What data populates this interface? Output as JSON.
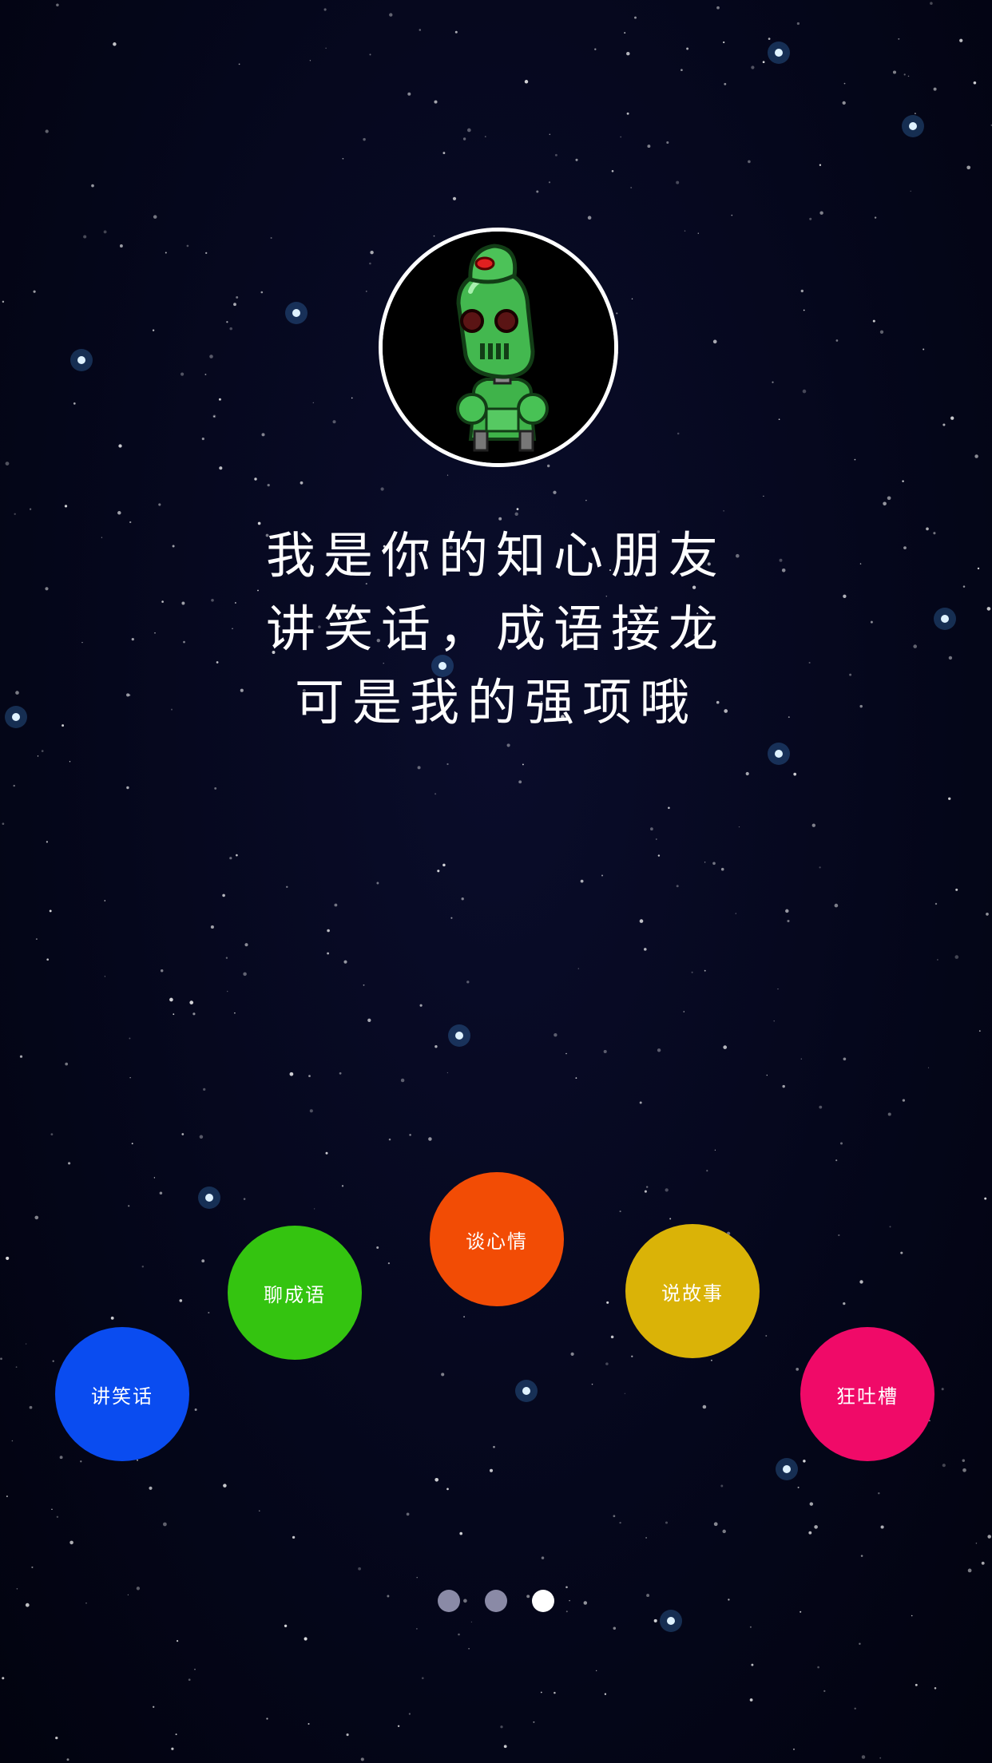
{
  "intro": {
    "line1": "我是你的知心朋友",
    "line2": "讲笑话，成语接龙",
    "line3": "可是我的强项哦"
  },
  "avatar": {
    "icon": "robot-icon",
    "ring_color": "#ffffff"
  },
  "features": [
    {
      "label": "讲笑话",
      "color": "#0a4cf0"
    },
    {
      "label": "聊成语",
      "color": "#34c410"
    },
    {
      "label": "谈心情",
      "color": "#f24c05"
    },
    {
      "label": "说故事",
      "color": "#dab307"
    },
    {
      "label": "狂吐槽",
      "color": "#f00a68"
    }
  ],
  "pager": {
    "total": 3,
    "current": 3,
    "active_color": "#ffffff",
    "inactive_color": "#8a8aa6"
  },
  "background": {
    "top": "#05071c",
    "bottom": "#02030f",
    "star_color": "#ffffff",
    "glow_color": "#4aa8ff"
  }
}
